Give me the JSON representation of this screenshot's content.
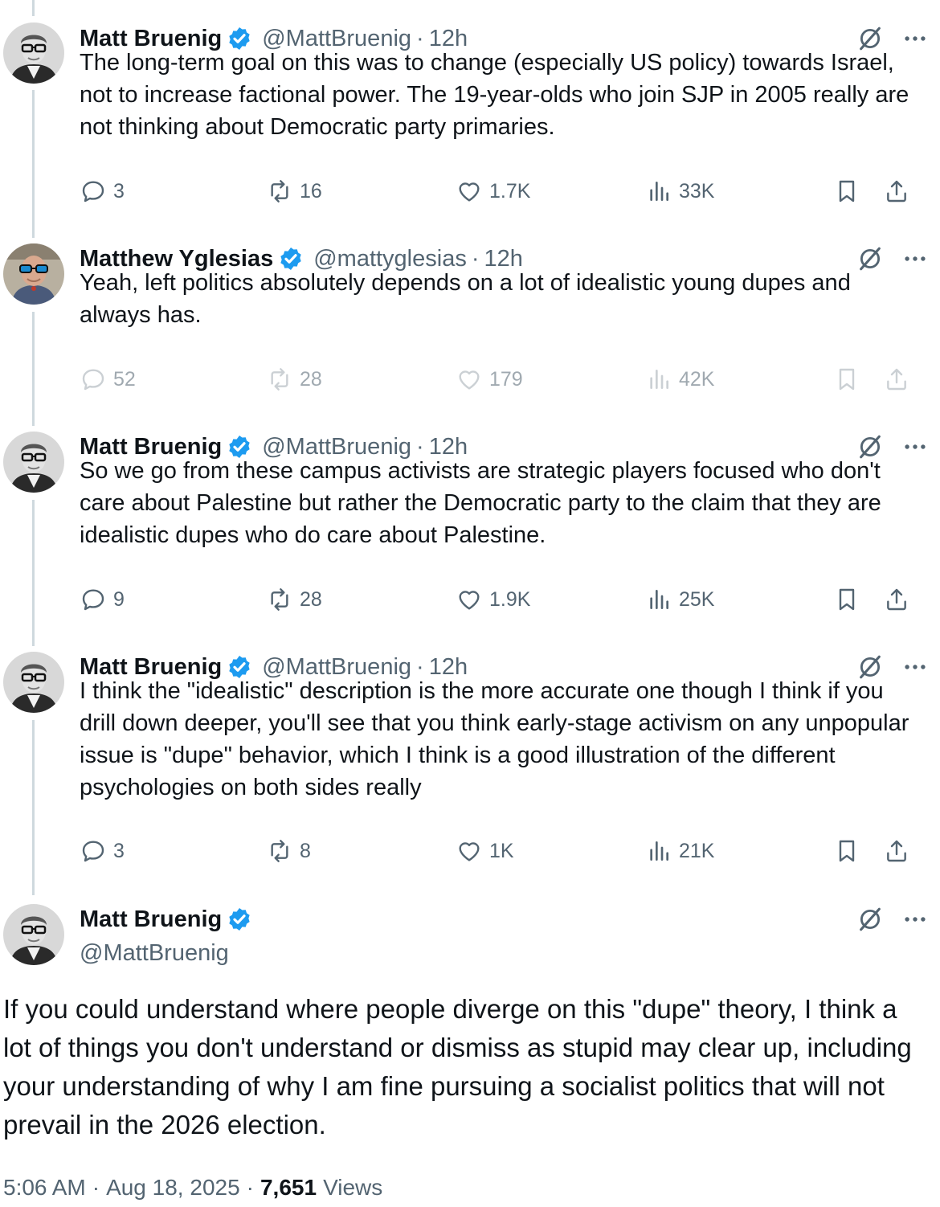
{
  "tweets": [
    {
      "name": "Matt Bruenig",
      "handle": "@MattBruenig",
      "separator": "·",
      "time": "12h",
      "text": "The long-term goal on this was to change (especially US policy) towards Israel, not to increase factional power. The 19-year-olds who join SJP in 2005 really are not thinking about Democratic party primaries.",
      "replies": "3",
      "reposts": "16",
      "likes": "1.7K",
      "views": "33K"
    },
    {
      "name": "Matthew Yglesias",
      "handle": "@mattyglesias",
      "separator": "·",
      "time": "12h",
      "text": "Yeah, left politics absolutely depends on a lot of idealistic young dupes and always has.",
      "replies": "52",
      "reposts": "28",
      "likes": "179",
      "views": "42K"
    },
    {
      "name": "Matt Bruenig",
      "handle": "@MattBruenig",
      "separator": "·",
      "time": "12h",
      "text": "So we go from these campus activists are strategic players focused who don't care about Palestine but rather the Democratic party to the claim that they are idealistic dupes who do care about Palestine.",
      "replies": "9",
      "reposts": "28",
      "likes": "1.9K",
      "views": "25K"
    },
    {
      "name": "Matt Bruenig",
      "handle": "@MattBruenig",
      "separator": "·",
      "time": "12h",
      "text": "I think the \"idealistic\" description is the more accurate one though I think if you drill down deeper, you'll see that you think early-stage activism on any unpopular issue is \"dupe\" behavior, which I think is a good illustration of the different psychologies on both sides really",
      "replies": "3",
      "reposts": "8",
      "likes": "1K",
      "views": "21K"
    }
  ],
  "main_tweet": {
    "name": "Matt Bruenig",
    "handle": "@MattBruenig",
    "text": "If you could understand where people diverge on this \"dupe\" theory, I think a lot of things you don't understand or dismiss as stupid may clear up, including your understanding of why I am fine pursuing a socialist politics that will not prevail in the 2026 election.",
    "time": "5:06 AM",
    "separator": "·",
    "date": "Aug 18, 2025",
    "views_count": "7,651",
    "views_label": "Views"
  },
  "icons": {
    "verified": "verified-badge-icon",
    "grok": "grok-icon",
    "more": "more-icon",
    "reply": "reply-icon",
    "repost": "repost-icon",
    "like": "like-icon",
    "views": "views-icon",
    "bookmark": "bookmark-icon",
    "share": "share-icon"
  },
  "colors": {
    "verified": "#1d9bf0",
    "text": "#0f1419",
    "secondary": "#536471",
    "thread_line": "#cfd9de"
  }
}
